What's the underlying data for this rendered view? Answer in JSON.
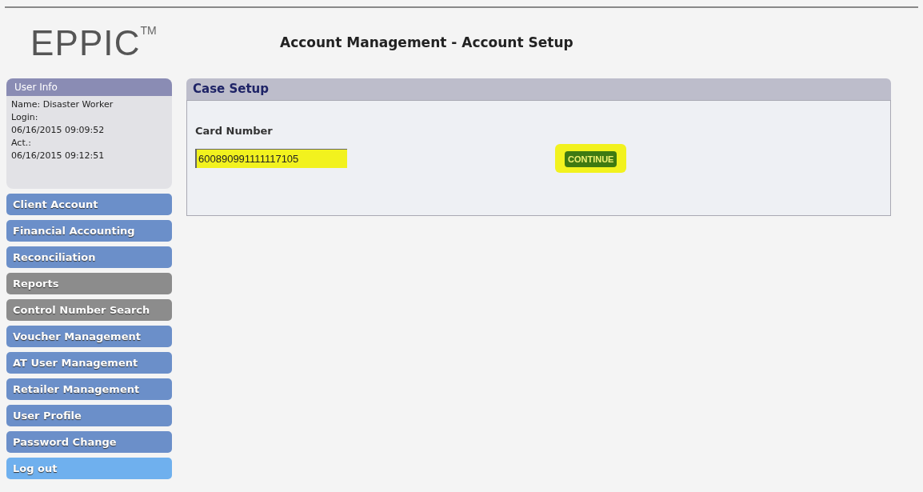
{
  "logo": {
    "text": "EPPIC",
    "mark": "TM"
  },
  "page_title": "Account Management - Account Setup",
  "user_info": {
    "title": "User Info",
    "lines": [
      "Name: Disaster Worker",
      "Login:",
      "06/16/2015 09:09:52",
      "Act.:",
      "06/16/2015 09:12:51"
    ]
  },
  "menu": [
    {
      "label": "Client Account",
      "color": "#6b8fc9"
    },
    {
      "label": "Financial Accounting",
      "color": "#6b8fc9"
    },
    {
      "label": "Reconciliation",
      "color": "#6b8fc9"
    },
    {
      "label": "Reports",
      "color": "#8c8c8c"
    },
    {
      "label": "Control Number Search",
      "color": "#8c8c8c"
    },
    {
      "label": "Voucher Management",
      "color": "#6b8fc9"
    },
    {
      "label": "AT User Management",
      "color": "#6b8fc9"
    },
    {
      "label": "Retailer Management",
      "color": "#6b8fc9"
    },
    {
      "label": "User Profile",
      "color": "#6b8fc9"
    },
    {
      "label": "Password Change",
      "color": "#6b8fc9"
    },
    {
      "label": "Log out",
      "color": "#6fb0ee"
    }
  ],
  "panel": {
    "title": "Case Setup",
    "field_label": "Card Number",
    "card_number": {
      "value": "600890991111117105",
      "highlighted": true
    },
    "continue_button": {
      "label": "CONTINUE",
      "highlighted": true
    }
  }
}
